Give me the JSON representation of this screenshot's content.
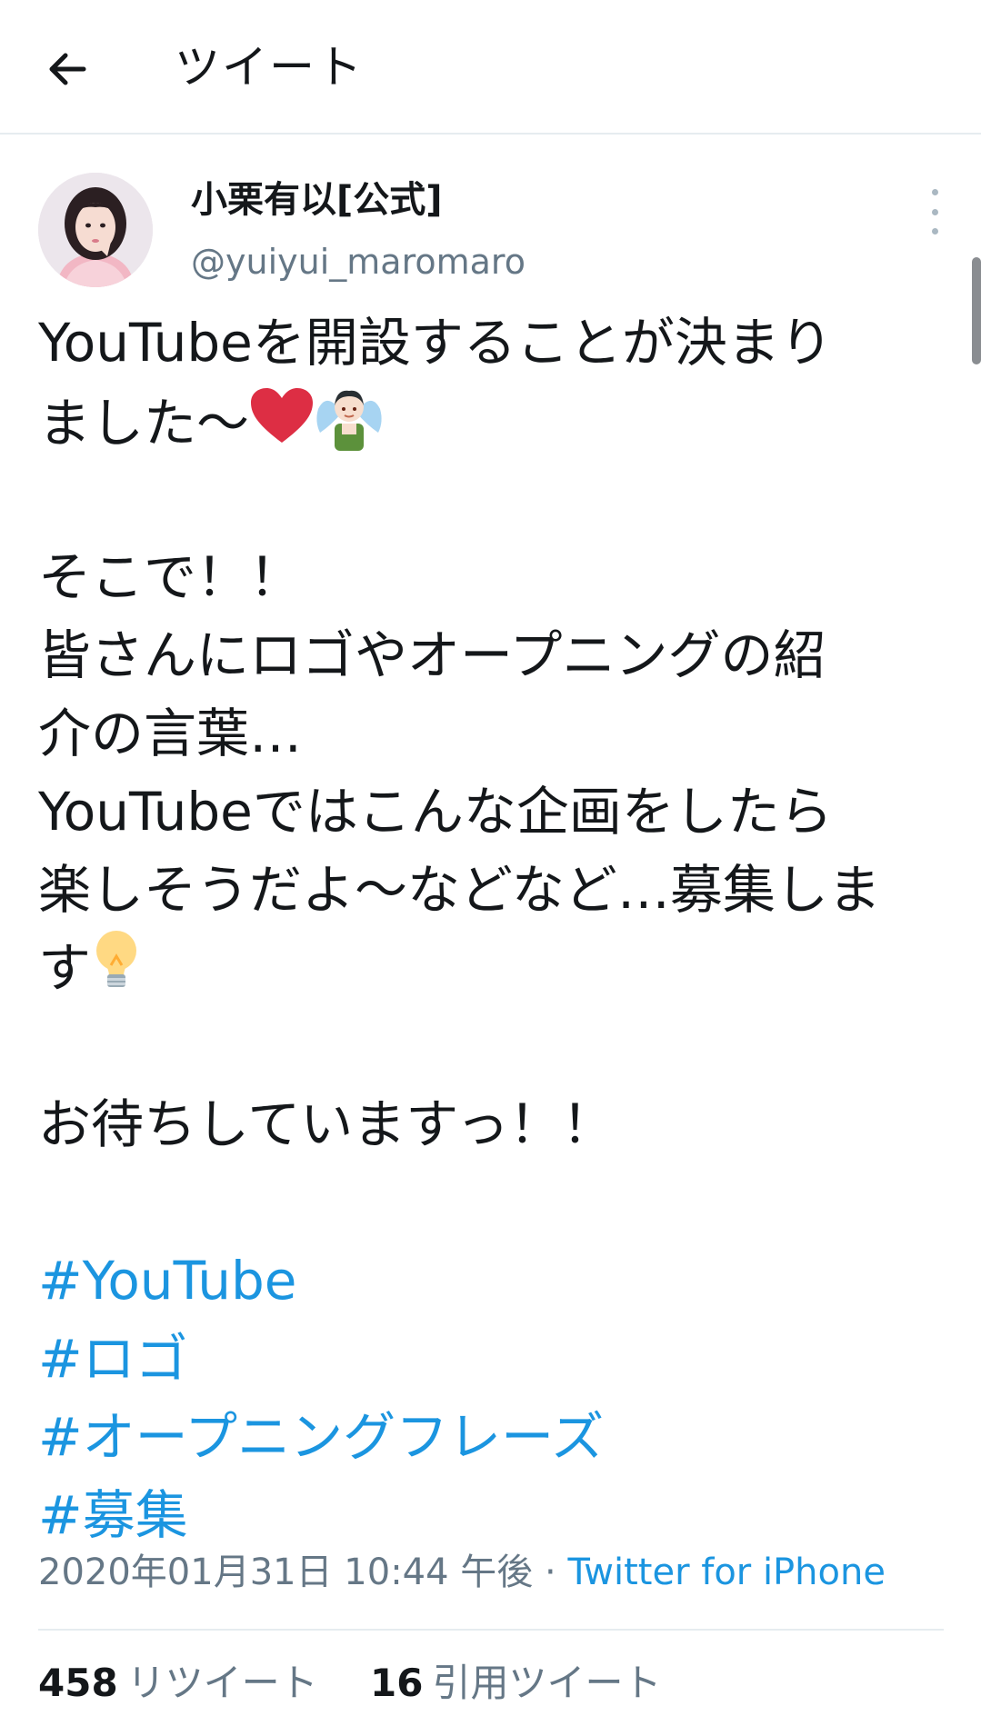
{
  "header": {
    "title": "ツイート",
    "back_icon": "arrow-left-icon"
  },
  "author": {
    "display_name": "小栗有以[公式]",
    "handle": "@yuiyui_maromaro",
    "avatar": "avatar-photo"
  },
  "tweet": {
    "lines": [
      "YouTubeを開設することが決まり",
      "ました〜",
      "",
      "そこで！！",
      "皆さんにロゴやオープニングの紹",
      "介の言葉…",
      "YouTubeではこんな企画をしたら",
      "楽しそうだよ〜などなど…募集しま",
      "す",
      "",
      "お待ちしていますっ！！",
      ""
    ],
    "emojis": [
      "red-heart-emoji",
      "man-fairy-emoji",
      "light-bulb-emoji"
    ],
    "hashtags": [
      "#YouTube",
      "#ロゴ",
      "#オープニングフレーズ",
      "#募集"
    ]
  },
  "meta": {
    "timestamp": "2020年01月31日 10:44 午後",
    "separator": " · ",
    "source": "Twitter for iPhone"
  },
  "stats": {
    "retweets_count": "458",
    "retweets_label": "リツイート",
    "quotes_count": "16",
    "quotes_label": "引用ツイート"
  },
  "colors": {
    "link": "#1b95e0",
    "secondary_text": "#657786",
    "primary_text": "#14171a",
    "divider": "#e6ecf0"
  }
}
